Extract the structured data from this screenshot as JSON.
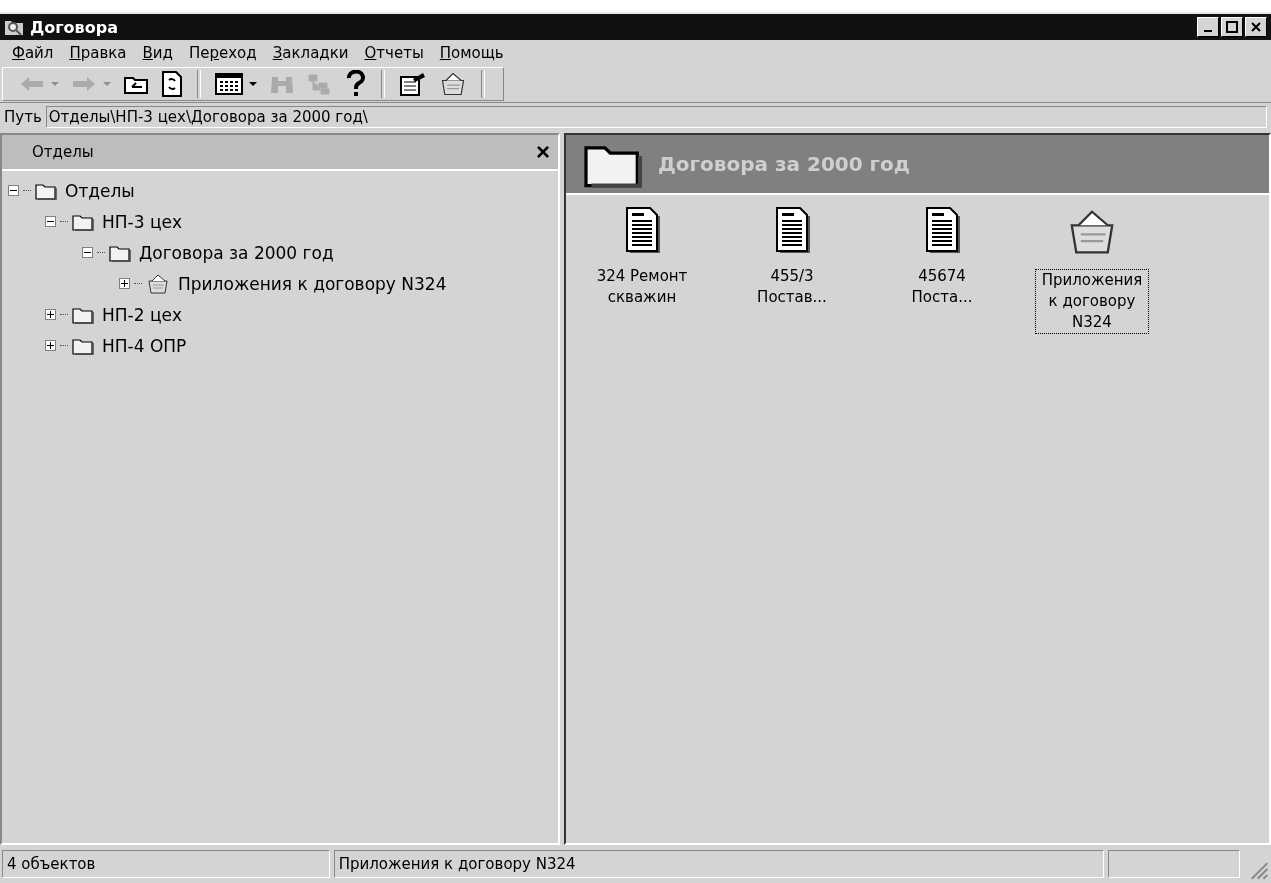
{
  "window": {
    "title": "Договора"
  },
  "menu": [
    {
      "key": "Ф",
      "after": "айл"
    },
    {
      "key": "П",
      "after": "равка"
    },
    {
      "key": "В",
      "after": "ид"
    },
    {
      "before": "Пе",
      "key": "р",
      "after": "еход"
    },
    {
      "key": "З",
      "after": "акладки"
    },
    {
      "key": "О",
      "after": "тчеты"
    },
    {
      "key": "П",
      "after": "омощь"
    }
  ],
  "toolbar": [
    {
      "kind": "back",
      "disabled": true,
      "dropdown": true
    },
    {
      "kind": "forward",
      "disabled": true,
      "dropdown": true
    },
    {
      "kind": "up",
      "disabled": false,
      "dropdown": false
    },
    {
      "kind": "refresh",
      "disabled": false,
      "dropdown": false
    },
    {
      "kind": "separator"
    },
    {
      "kind": "view",
      "disabled": false,
      "dropdown": true
    },
    {
      "kind": "find",
      "disabled": true,
      "dropdown": false
    },
    {
      "kind": "tree",
      "disabled": true,
      "dropdown": false
    },
    {
      "kind": "help",
      "disabled": false,
      "dropdown": false
    },
    {
      "kind": "separator"
    },
    {
      "kind": "properties",
      "disabled": false,
      "dropdown": false
    },
    {
      "kind": "basket",
      "disabled": false,
      "dropdown": false
    },
    {
      "kind": "separator"
    }
  ],
  "path": {
    "label": "Путь",
    "value": "Отделы\\НП-3 цех\\Договора за 2000 год\\"
  },
  "tree_pane": {
    "title": "Отделы",
    "close": "×",
    "items": [
      {
        "label": "Отделы",
        "kind": "folder",
        "expanded": true,
        "children": [
          {
            "label": "НП-3 цех",
            "kind": "folder",
            "expanded": true,
            "children": [
              {
                "label": "Договора за 2000 год",
                "kind": "folder",
                "expanded": true,
                "children": [
                  {
                    "label": "Приложения к договору N324",
                    "kind": "basket",
                    "expanded": false
                  }
                ]
              }
            ]
          },
          {
            "label": "НП-2 цех",
            "kind": "folder",
            "expanded": false
          },
          {
            "label": "НП-4 ОПР",
            "kind": "folder",
            "expanded": false
          }
        ]
      }
    ]
  },
  "content": {
    "title": "Договора за 2000 год",
    "items": [
      {
        "label": "324 Ремонт скважин",
        "kind": "document",
        "selected": false
      },
      {
        "label": "455/3 Постав...",
        "kind": "document",
        "selected": false
      },
      {
        "label": "45674 Поста...",
        "kind": "document",
        "selected": false
      },
      {
        "label": "Приложения к договору N324",
        "kind": "basket",
        "selected": true
      }
    ]
  },
  "status_bar": [
    "4 объектов",
    "Приложения к договору N324"
  ]
}
